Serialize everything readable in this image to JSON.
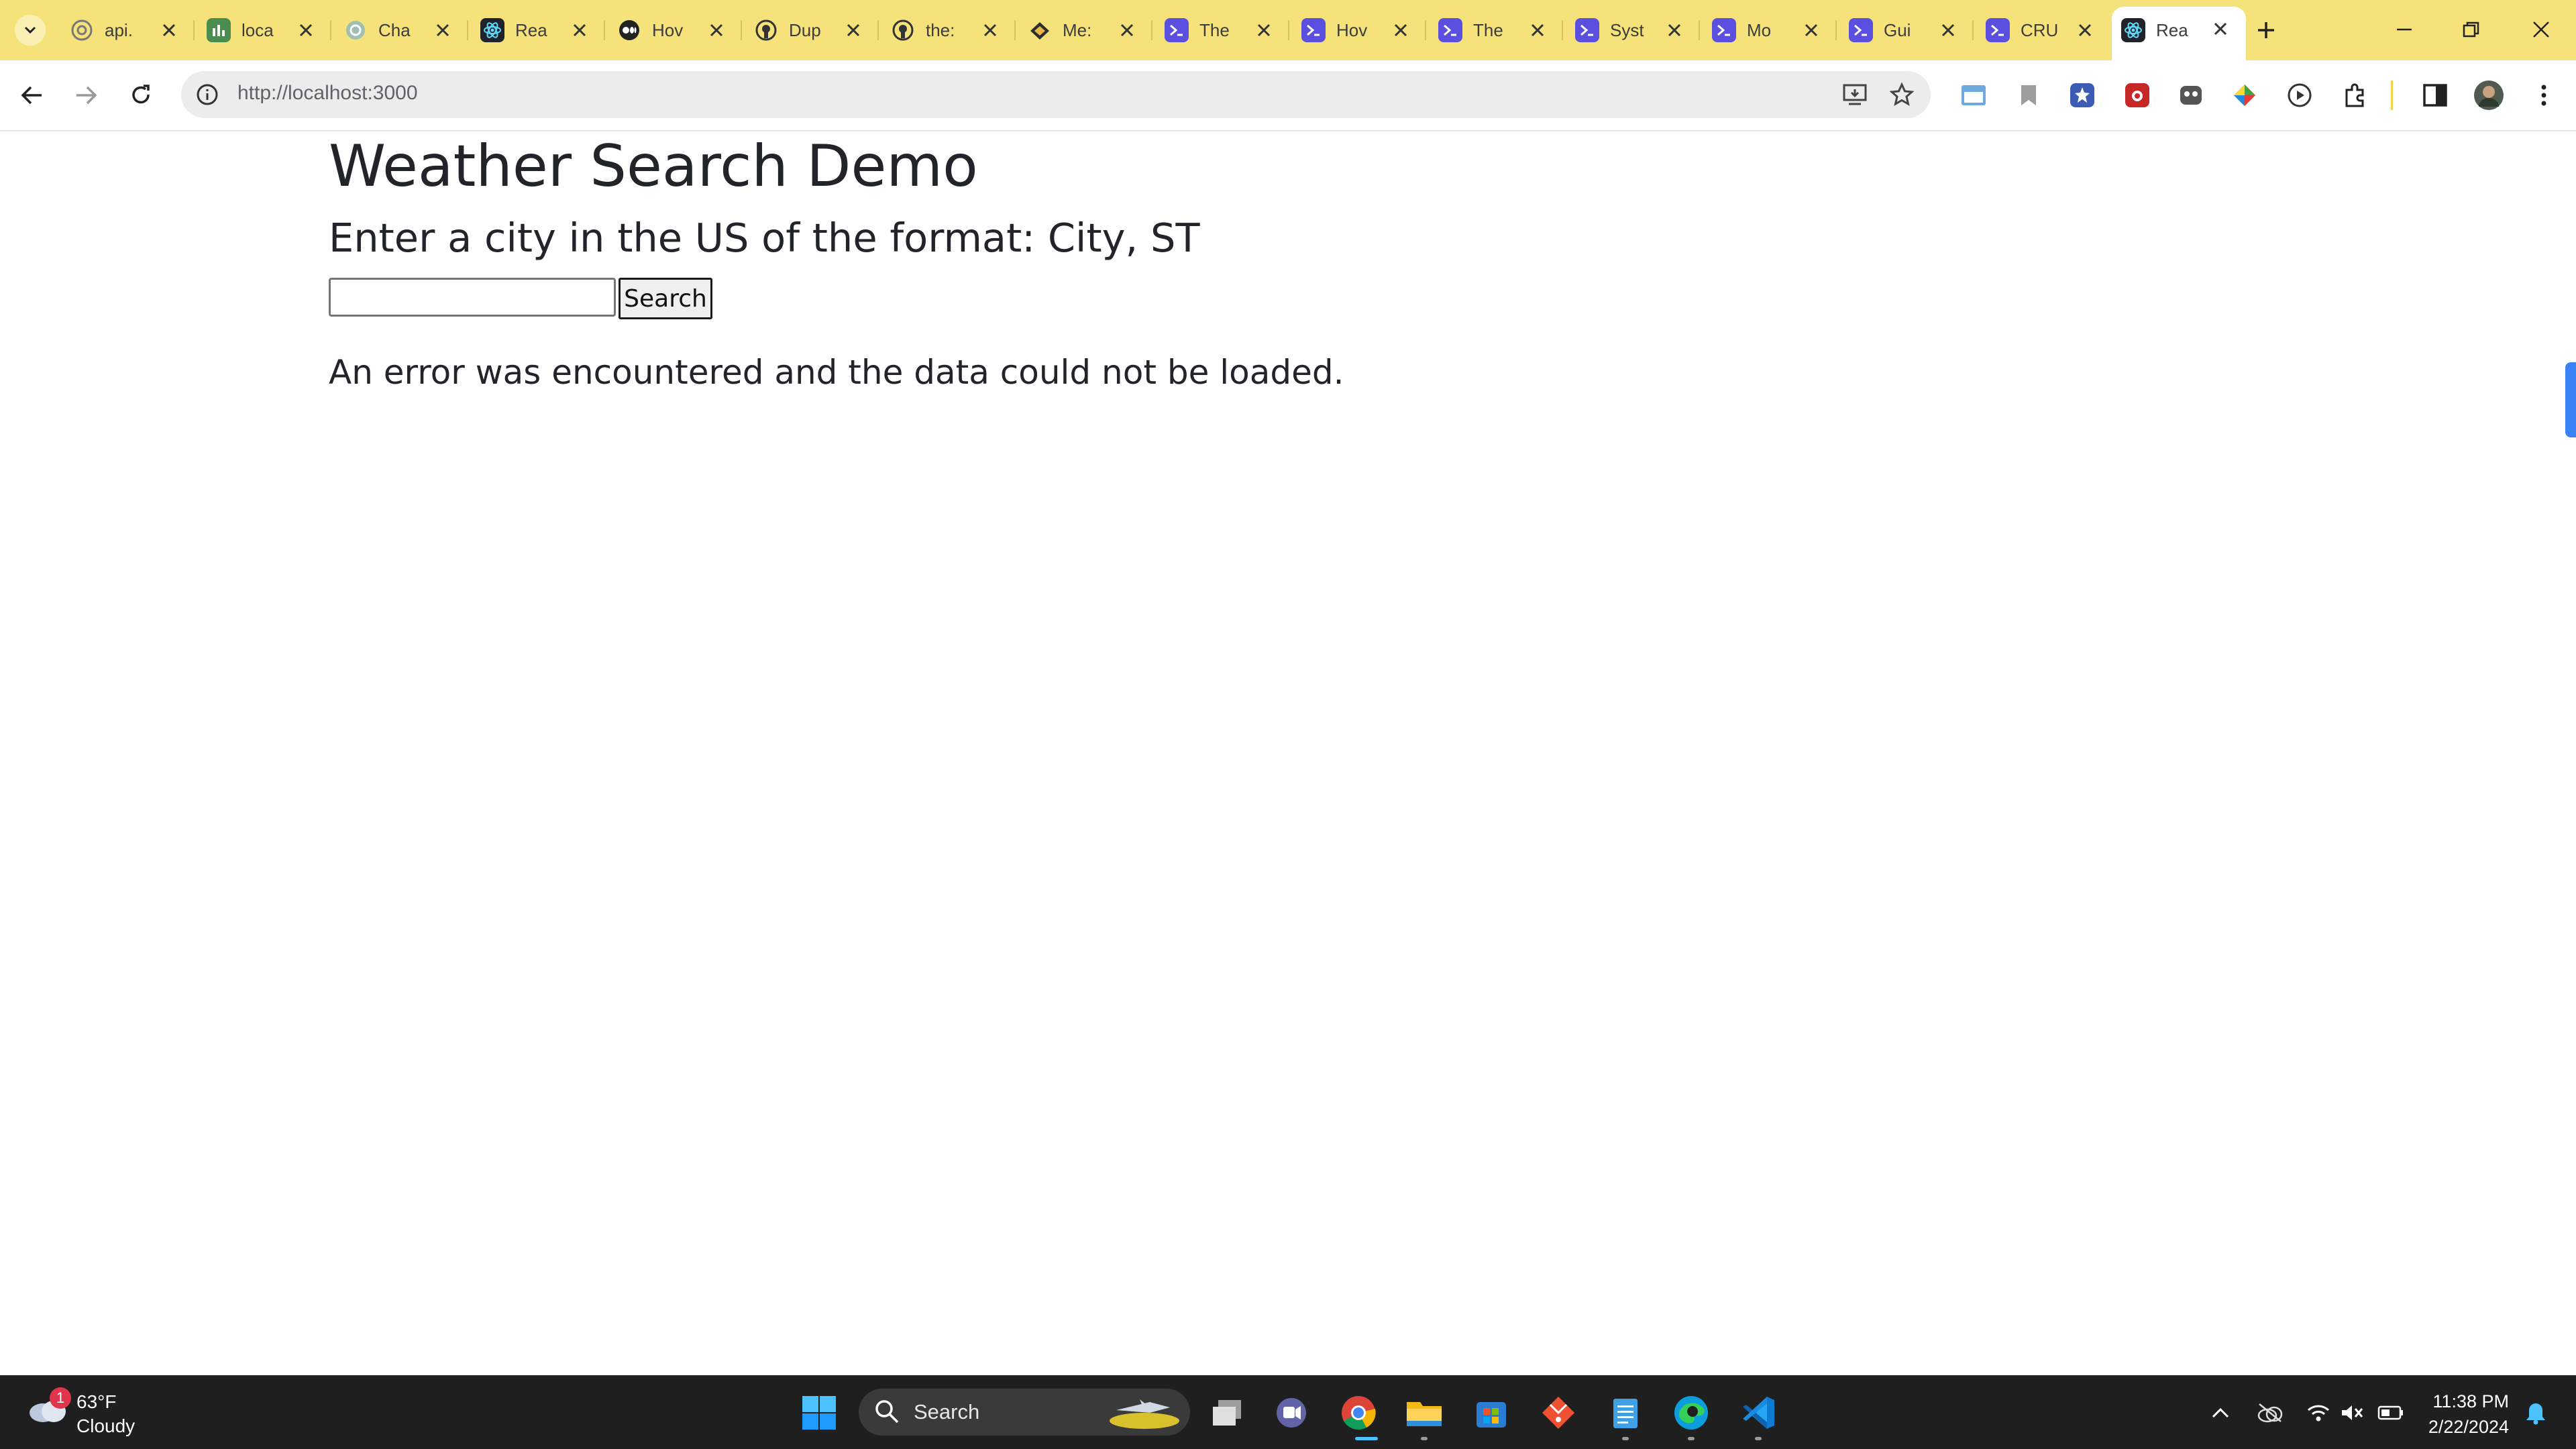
{
  "browser": {
    "tabs": [
      {
        "title": "api.",
        "icon": "openai-icon"
      },
      {
        "title": "loca",
        "icon": "chart-app-icon"
      },
      {
        "title": "Cha",
        "icon": "chatgpt-icon"
      },
      {
        "title": "Rea",
        "icon": "react-icon"
      },
      {
        "title": "Hov",
        "icon": "medium-icon"
      },
      {
        "title": "Dup",
        "icon": "github-icon"
      },
      {
        "title": "the:",
        "icon": "github-icon"
      },
      {
        "title": "Me:",
        "icon": "web-app-icon"
      },
      {
        "title": "The",
        "icon": "powershell-icon"
      },
      {
        "title": "Hov",
        "icon": "powershell-icon"
      },
      {
        "title": "The",
        "icon": "powershell-icon"
      },
      {
        "title": "Syst",
        "icon": "powershell-icon"
      },
      {
        "title": "Mo",
        "icon": "powershell-icon"
      },
      {
        "title": "Gui",
        "icon": "powershell-icon"
      },
      {
        "title": "CRU",
        "icon": "powershell-icon"
      },
      {
        "title": "Rea",
        "icon": "react-icon",
        "active": true
      }
    ],
    "url": "http://localhost:3000",
    "accent_color": "#f6e27a"
  },
  "page": {
    "title": "Weather Search Demo",
    "subtitle": "Enter a city in the US of the format: City, ST",
    "search_input_value": "",
    "search_button": "Search",
    "error_message": "An error was encountered and the data could not be loaded."
  },
  "taskbar": {
    "weather": {
      "badge": "1",
      "temperature": "63°F",
      "condition": "Cloudy"
    },
    "search_label": "Search",
    "apps": [
      "windows-start-icon",
      "task-view-icon",
      "teams-chat-icon",
      "chrome-icon",
      "file-explorer-icon",
      "microsoft-store-icon",
      "git-icon",
      "notepad-icon",
      "edge-icon",
      "vscode-icon"
    ],
    "clock": {
      "time": "11:38 PM",
      "date": "2/22/2024"
    }
  }
}
